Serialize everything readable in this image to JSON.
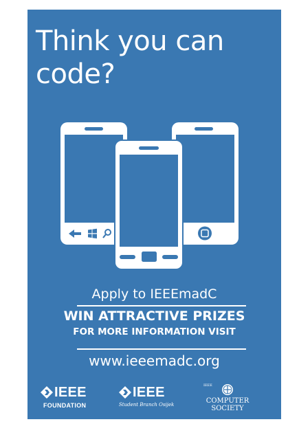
{
  "poster": {
    "headline_line1": "Think you can",
    "headline_line2": "code?",
    "apply_text": "Apply to IEEEmadC",
    "prizes_text": "WIN ATTRACTIVE PRIZES",
    "more_info_text": "FOR MORE INFORMATION VISIT",
    "url_text": "www.ieeemadc.org",
    "background_color": "#3a78b2"
  },
  "illustration": {
    "icons": [
      "phone-left-icon",
      "phone-center-icon",
      "phone-right-icon",
      "back-arrow-icon",
      "windows-logo-icon",
      "search-icon",
      "home-square-icon"
    ]
  },
  "logos": {
    "ieee_foundation_word": "IEEE",
    "ieee_foundation_sub": "FOUNDATION",
    "ieee_branch_word": "IEEE",
    "ieee_branch_sub": "Student Branch Osijek",
    "computer_society_small": "IEEE",
    "computer_society_line1": "COMPUTER",
    "computer_society_line2": "SOCIETY"
  }
}
